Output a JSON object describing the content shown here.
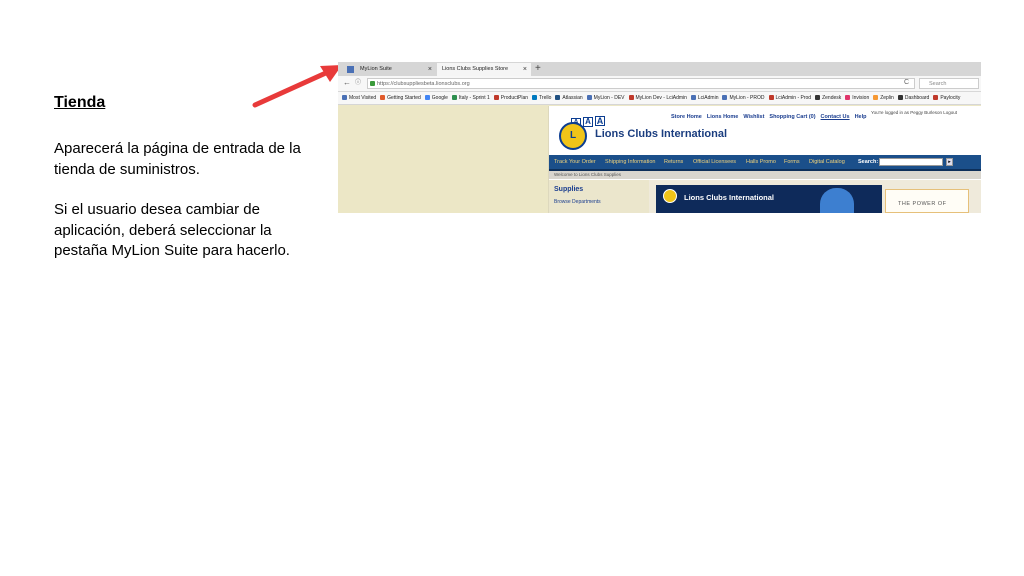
{
  "slide": {
    "title": "Tienda",
    "paragraph1": "Aparecerá la página de entrada de la tienda de suministros.",
    "paragraph2": "Si el usuario desea cambiar de aplicación, deberá seleccionar la pestaña MyLion Suite para hacerlo."
  },
  "colors": {
    "arrow": "#e83a3a",
    "brand_blue": "#1b4f8a",
    "brand_gold": "#f0c419"
  },
  "browser": {
    "tabs": [
      {
        "label": "MyLion Suite",
        "active": false
      },
      {
        "label": "Lions Clubs Supplies Store",
        "active": true
      }
    ],
    "new_tab": "+",
    "close_glyph": "×",
    "back": "←",
    "info": "ⓘ",
    "url": "https://clubsuppliesbeta.lionsclubs.org",
    "reload": "C",
    "search_placeholder": "Search",
    "bookmarks": [
      {
        "label": "Most Visited",
        "color": "#4a70b5"
      },
      {
        "label": "Getting Started",
        "color": "#e05a2a"
      },
      {
        "label": "Google",
        "color": "#4285f4"
      },
      {
        "label": "Italy - Sprint 1",
        "color": "#2d8f4e"
      },
      {
        "label": "ProductPlan",
        "color": "#c0392b"
      },
      {
        "label": "Trello",
        "color": "#0079bf"
      },
      {
        "label": "Atlassian",
        "color": "#205081"
      },
      {
        "label": "MyLion - DEV",
        "color": "#4a70b5"
      },
      {
        "label": "MyLion Dev - LciAdmin",
        "color": "#c0392b"
      },
      {
        "label": "LciAdmin",
        "color": "#4a70b5"
      },
      {
        "label": "MyLion - PROD",
        "color": "#4a70b5"
      },
      {
        "label": "LciAdmin - Prod",
        "color": "#c0392b"
      },
      {
        "label": "Zendesk",
        "color": "#333333"
      },
      {
        "label": "Invision",
        "color": "#e0356b"
      },
      {
        "label": "Zeplin",
        "color": "#f69833"
      },
      {
        "label": "Dashboard",
        "color": "#333333"
      },
      {
        "label": "Paylocity",
        "color": "#c0392b"
      }
    ]
  },
  "store": {
    "size_buttons": [
      "A",
      "A",
      "A"
    ],
    "top_links": [
      "Store Home",
      "Lions Home",
      "Wishlist",
      "Shopping Cart (0)",
      "Contact Us",
      "Help"
    ],
    "logged_in": "You're logged in as Peggy Burleson Logout",
    "logo_letter": "L",
    "org_name": "Lions Clubs International",
    "menu": [
      "Track Your Order",
      "Shipping Information",
      "Returns",
      "Official Licensees",
      "Halls Promo",
      "Forms",
      "Digital Catalog"
    ],
    "search_label": "Search:",
    "search_go": "▸",
    "welcome": "Welcome to Lions Clubs Supplies",
    "sidebar_title": "Supplies",
    "sidebar_link": "Browse Departments",
    "banner_text": "Lions Clubs International",
    "power_text": "THE POWER OF"
  }
}
